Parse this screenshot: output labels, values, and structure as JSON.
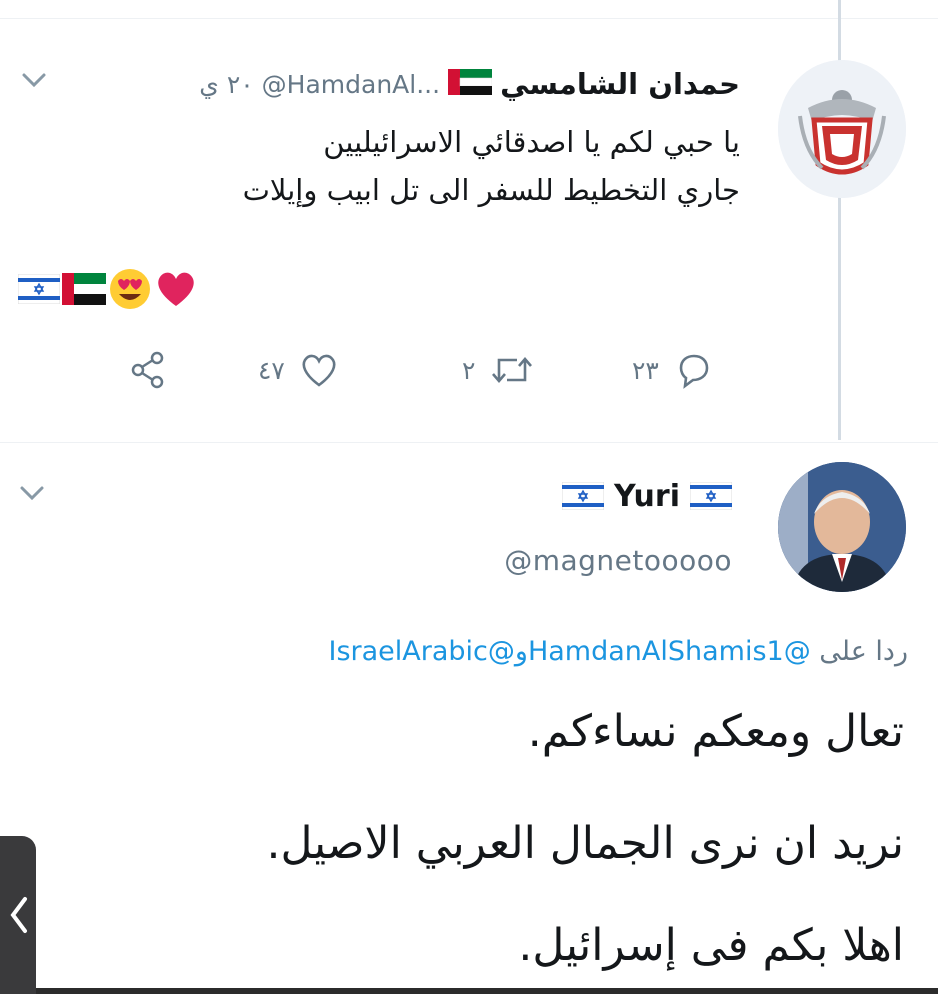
{
  "tweet1": {
    "author_name": "حمدان الشامسي",
    "handle": "@HamdanAl...",
    "time": "٢٠ ي",
    "text_line1": "يا حبي لكم يا اصدقائي الاسرائيليين",
    "text_line2": "جاري التخطيط للسفر الى تل ابيب وإيلات",
    "actions": {
      "replies": "٢٣",
      "retweets": "٢",
      "likes": "٤٧"
    },
    "emoji_icons": [
      "red-heart-icon",
      "heart-eyes-icon",
      "uae-flag-icon",
      "israel-flag-icon"
    ]
  },
  "tweet2": {
    "author_name": "Yuri",
    "handle": "@magnetooooo",
    "reply_prefix": "ردا على",
    "reply_mention1": "@HamdanAlShamis1",
    "reply_joiner": "و",
    "reply_mention2": "@IsraelArabic",
    "line1": "تعال ومعكم نساءكم.",
    "line2": "نريد ان نرى الجمال العربي الاصيل.",
    "line3": "اهلا بكم فى إسرائيل."
  },
  "colors": {
    "link": "#1b95e0",
    "muted": "#657786",
    "text": "#14171a",
    "like": "#e0245e"
  }
}
